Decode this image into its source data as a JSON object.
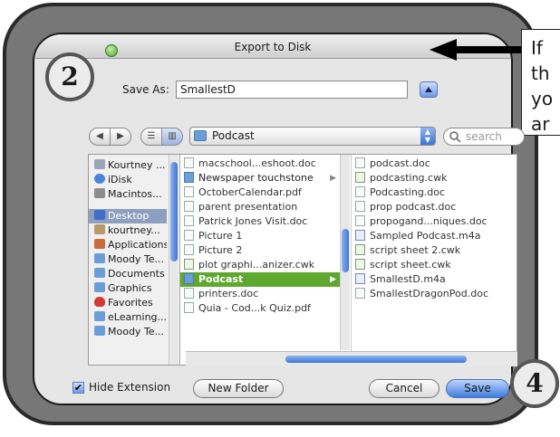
{
  "dialog": {
    "title": "Export to Disk",
    "save_as_label": "Save As:",
    "save_as_value": "SmallestD",
    "location": "Podcast",
    "search_placeholder": "search"
  },
  "annotations": {
    "step_a": "2",
    "step_b": "4",
    "callout_lines": [
      "If",
      "th",
      "yo",
      "ar"
    ]
  },
  "sidebar": {
    "items": [
      {
        "label": "Kourtney ...",
        "icon": "computer-icon"
      },
      {
        "label": "iDisk",
        "icon": "idisk-icon"
      },
      {
        "label": "Macintos...",
        "icon": "hard-drive-icon"
      },
      {
        "label": "Desktop",
        "icon": "desktop-icon",
        "selected": true
      },
      {
        "label": "kourtney...",
        "icon": "home-icon"
      },
      {
        "label": "Applications",
        "icon": "applications-icon"
      },
      {
        "label": "Moody Te...",
        "icon": "folder-icon"
      },
      {
        "label": "Documents",
        "icon": "folder-icon"
      },
      {
        "label": "Graphics",
        "icon": "folder-icon"
      },
      {
        "label": "Favorites",
        "icon": "heart-icon"
      },
      {
        "label": "eLearning...",
        "icon": "folder-icon"
      },
      {
        "label": "Moody Te...",
        "icon": "folder-icon"
      }
    ]
  },
  "column1": {
    "items": [
      {
        "label": "macschool...eshoot.doc",
        "kind": "doc"
      },
      {
        "label": "Newspaper touchstone",
        "kind": "folder"
      },
      {
        "label": "OctoberCalendar.pdf",
        "kind": "doc"
      },
      {
        "label": "parent presentation",
        "kind": "doc"
      },
      {
        "label": "Patrick Jones Visit.doc",
        "kind": "doc"
      },
      {
        "label": "Picture 1",
        "kind": "doc"
      },
      {
        "label": "Picture 2",
        "kind": "doc"
      },
      {
        "label": "plot graphi...anizer.cwk",
        "kind": "cwk"
      },
      {
        "label": "Podcast",
        "kind": "folder",
        "selected": true
      },
      {
        "label": "printers.doc",
        "kind": "doc"
      },
      {
        "label": "Quia - Cod...k Quiz.pdf",
        "kind": "doc"
      }
    ]
  },
  "column2": {
    "items": [
      {
        "label": "podcast.doc",
        "kind": "doc"
      },
      {
        "label": "podcasting.cwk",
        "kind": "cwk"
      },
      {
        "label": "Podcasting.doc",
        "kind": "doc"
      },
      {
        "label": "prop podcast.doc",
        "kind": "doc"
      },
      {
        "label": "propogand...niques.doc",
        "kind": "doc"
      },
      {
        "label": "Sampled Podcast.m4a",
        "kind": "m4a"
      },
      {
        "label": "script sheet 2.cwk",
        "kind": "cwk"
      },
      {
        "label": "script sheet.cwk",
        "kind": "cwk"
      },
      {
        "label": "SmallestD.m4a",
        "kind": "m4a"
      },
      {
        "label": "SmallestDragonPod.doc",
        "kind": "doc"
      }
    ]
  },
  "footer": {
    "hide_extension_label": "Hide Extension",
    "hide_extension_checked": true,
    "new_folder_label": "New Folder",
    "cancel_label": "Cancel",
    "save_label": "Save"
  },
  "colors": {
    "selection_green": "#5fa82f",
    "sidebar_selection": "#8f9fbf",
    "aqua_blue": "#3e74d4"
  }
}
